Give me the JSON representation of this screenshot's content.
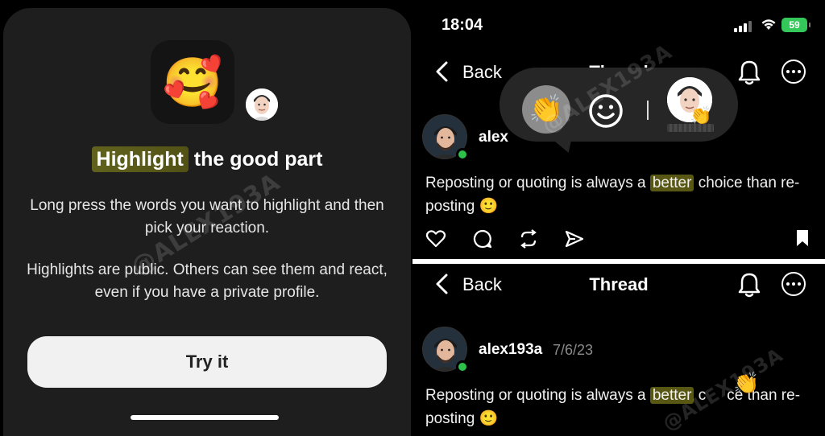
{
  "left_screen": {
    "emoji": "🥰",
    "headline_highlight": "Highlight",
    "headline_rest": " the good part",
    "paragraph_1": "Long press the words you want to highlight and then pick your reaction.",
    "paragraph_2": "Highlights are public. Others can see them and react, even if you have a private profile.",
    "button_label": "Try it",
    "watermark": "@ALEX193A"
  },
  "status_bar": {
    "time": "18:04",
    "battery": "59"
  },
  "top_thread": {
    "back_label": "Back",
    "title": "Thread",
    "username": "alex",
    "post_before": "Reposting or quoting is always a ",
    "post_highlight": "better",
    "post_after": " choice than re-posting ",
    "post_emoji": "🙂",
    "reaction_bar": {
      "clap_emoji": "👏",
      "smile_icon": "smile-icon",
      "avatar_badge": "👏"
    },
    "watermark": "@ALEX193A"
  },
  "bottom_thread": {
    "back_label": "Back",
    "title": "Thread",
    "username": "alex193a",
    "date": "7/6/23",
    "post_before": "Reposting or quoting is always a ",
    "post_highlight": "better",
    "post_after_1": " c",
    "post_after_2": "ce than re-posting ",
    "post_emoji": "🙂",
    "clap_mark": "👏",
    "watermark": "@ALEX193A"
  },
  "colors": {
    "highlight": "#6e6e1e",
    "online": "#2ec14a",
    "battery": "#34c759",
    "sheet_bg": "#1e1e1e"
  }
}
